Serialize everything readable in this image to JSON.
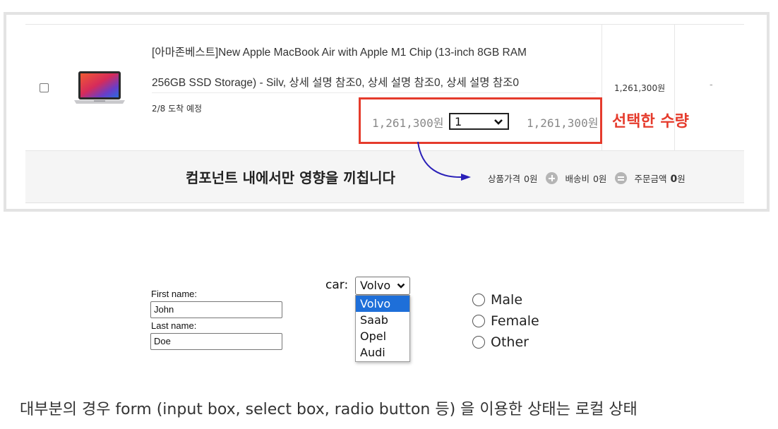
{
  "cart": {
    "product_title_line1": "[아마존베스트]New Apple MacBook Air with Apple M1 Chip (13-inch 8GB RAM",
    "product_title_line2": "256GB SSD Storage) - Silv, 상세 설명 참조0, 상세 설명 참조0, 상세 설명 참조0",
    "delivery": "2/8 도착 예정",
    "unit_price": "1,261,300원",
    "quantity_value": "1",
    "line_total": "1,261,300원",
    "row_price": "1,261,300원",
    "row_dash": "-",
    "quantity_annotation": "선택한 수량",
    "component_note": "컴포넌트 내에서만 영향을 끼칩니다",
    "summary": {
      "product_label": "상품가격",
      "product_amount": "0원",
      "shipping_label": "배송비",
      "shipping_amount": "0원",
      "order_label": "주문금액",
      "order_amount_number": "0",
      "order_amount_unit": "원"
    }
  },
  "form_demo": {
    "first_name_label": "First name:",
    "first_name_value": "John",
    "last_name_label": "Last name:",
    "last_name_value": "Doe",
    "car_label": "car:",
    "car_selected": "Volvo",
    "car_options": [
      "Volvo",
      "Saab",
      "Opel",
      "Audi"
    ],
    "radio_options": [
      "Male",
      "Female",
      "Other"
    ]
  },
  "footer_text": "대부분의 경우 form (input box, select box, radio button 등) 을 이용한 상태는 로컬 상태",
  "colors": {
    "highlight": "#e53b2c",
    "arrow": "#2a20b8",
    "option_selected": "#1e6fd9"
  },
  "icons": [
    "macbook-thumbnail",
    "chevron-down-icon",
    "plus-circle-icon",
    "equal-circle-icon",
    "curved-arrow"
  ]
}
